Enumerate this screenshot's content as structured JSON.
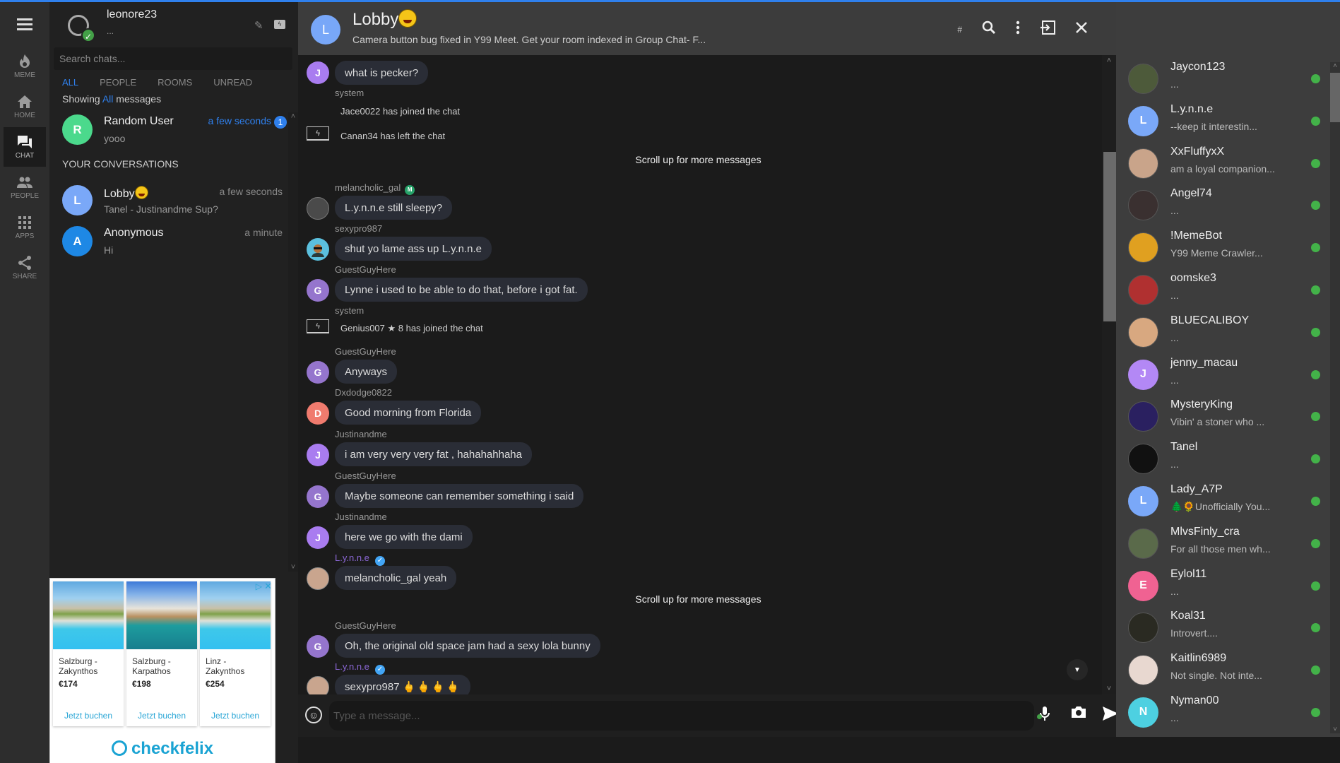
{
  "rail": {
    "items": [
      {
        "label": "MEME",
        "icon": "flame-icon"
      },
      {
        "label": "HOME",
        "icon": "home-icon"
      },
      {
        "label": "CHAT",
        "icon": "chat-icon",
        "active": true
      },
      {
        "label": "PEOPLE",
        "icon": "people-icon"
      },
      {
        "label": "APPS",
        "icon": "apps-grid-icon"
      },
      {
        "label": "SHARE",
        "icon": "share-icon"
      }
    ]
  },
  "profile": {
    "username": "leonore23",
    "status": "..."
  },
  "search": {
    "placeholder": "Search chats..."
  },
  "filters": {
    "tabs": [
      "ALL",
      "PEOPLE",
      "ROOMS",
      "UNREAD"
    ],
    "active": "ALL"
  },
  "showing": {
    "prefix": "Showing",
    "highlight": "All",
    "suffix": "messages"
  },
  "unread_conv": {
    "initial": "R",
    "name": "Random User",
    "preview": "yooo",
    "time": "a few seconds",
    "count": "1",
    "color": "#4bd98c"
  },
  "conversations": {
    "title": "YOUR CONVERSATIONS",
    "items": [
      {
        "initial": "L",
        "name": "Lobby",
        "has_emoji": true,
        "preview": "Tanel - Justinandme Sup?",
        "time": "a few seconds",
        "color": "#7aa8f8"
      },
      {
        "initial": "A",
        "name": "Anonymous",
        "preview": "Hi",
        "time": "a minute",
        "color": "#1e88e5"
      }
    ]
  },
  "ad": {
    "cards": [
      {
        "dest": "Salzburg - Zakynthos",
        "price": "€174",
        "cta": "Jetzt buchen"
      },
      {
        "dest": "Salzburg - Karpathos",
        "price": "€198",
        "cta": "Jetzt buchen"
      },
      {
        "dest": "Linz - Zakynthos",
        "price": "€254",
        "cta": "Jetzt buchen"
      }
    ],
    "brand": "checkfelix"
  },
  "room": {
    "initial": "L",
    "title": "Lobby",
    "description": "Camera button bug fixed in Y99 Meet. Get your room indexed in Group Chat- F...",
    "tools": [
      "hash-icon",
      "search-icon",
      "more-vert-icon",
      "exit-icon",
      "close-icon"
    ]
  },
  "messages": {
    "scroll_more": "Scroll up for more messages",
    "items": [
      {
        "user": "",
        "initial": "J",
        "color": "#a97cf0",
        "text": "what is pecker?"
      },
      {
        "system_label": "system",
        "lines": [
          "Jace0022 has joined the chat",
          "Canan34 has left the chat"
        ]
      },
      {
        "user": "melancholic_gal",
        "badge": "M",
        "avatar": "photo",
        "text": "L.y.n.n.e still sleepy?"
      },
      {
        "user": "sexypro987",
        "avatar": "photo",
        "text": "shut yo lame ass up L.y.n.n.e"
      },
      {
        "user": "GuestGuyHere",
        "initial": "G",
        "color": "#9575cd",
        "text": "Lynne i used to be able to do that, before i got fat."
      },
      {
        "system_label": "system",
        "lines": [
          "Genius007 ★ 8 has joined the chat"
        ]
      },
      {
        "user": "GuestGuyHere",
        "initial": "G",
        "color": "#9575cd",
        "text": "Anyways"
      },
      {
        "user": "Dxdodge0822",
        "initial": "D",
        "color": "#f07b6e",
        "text": "Good morning from Florida"
      },
      {
        "user": "Justinandme",
        "initial": "J",
        "color": "#a97cf0",
        "text": "i am very very very fat , hahahahhaha"
      },
      {
        "user": "GuestGuyHere",
        "initial": "G",
        "color": "#9575cd",
        "text": "Maybe someone can remember something i said"
      },
      {
        "user": "Justinandme",
        "initial": "J",
        "color": "#a97cf0",
        "text": "here we go with the dami"
      },
      {
        "user": "L.y.n.n.e",
        "verified": true,
        "avatar": "photo",
        "text": "melancholic_gal yeah"
      },
      {
        "user": "GuestGuyHere",
        "initial": "G",
        "color": "#9575cd",
        "text": "Oh, the original old space jam had a sexy lola bunny"
      },
      {
        "user": "L.y.n.n.e",
        "verified": true,
        "avatar": "photo",
        "text": "sexypro987",
        "emoji": "🖕🖕🖕🖕"
      }
    ]
  },
  "composer": {
    "placeholder": "Type a message...",
    "value": ""
  },
  "online_users": [
    {
      "name": "Jaycon123",
      "status": "...",
      "avatar": "photo",
      "color": "#4d5a3a"
    },
    {
      "name": "L.y.n.n.e",
      "status": "--keep it interestin...",
      "initial": "L",
      "color": "#7aa8f8"
    },
    {
      "name": "XxFluffyxX",
      "status": "am a loyal companion...",
      "avatar": "photo",
      "color": "#c9a48a"
    },
    {
      "name": "Angel74",
      "status": "...",
      "avatar": "photo",
      "color": "#3a3030"
    },
    {
      "name": "!MemeBot",
      "status": "Y99 Meme Crawler...",
      "avatar": "photo",
      "color": "#e0a020"
    },
    {
      "name": "oomske3",
      "status": "...",
      "avatar": "photo",
      "color": "#b03030"
    },
    {
      "name": "BLUECALIBOY",
      "status": "...",
      "avatar": "photo",
      "color": "#d8a880"
    },
    {
      "name": "jenny_macau",
      "status": "...",
      "initial": "J",
      "color": "#b388f5"
    },
    {
      "name": "MysteryKing",
      "status": "Vibin' a stoner who ...",
      "avatar": "photo",
      "color": "#2a2060"
    },
    {
      "name": "Tanel",
      "status": "...",
      "avatar": "photo",
      "color": "#111111"
    },
    {
      "name": "Lady_A7P",
      "status": "🌲🌻Unofficially You...",
      "initial": "L",
      "color": "#7aa8f8"
    },
    {
      "name": "MlvsFinly_cra",
      "status": "For all those men wh...",
      "avatar": "photo",
      "color": "#5a6a4a"
    },
    {
      "name": "Eylol11",
      "status": "...",
      "initial": "E",
      "color": "#f06292"
    },
    {
      "name": "Koal31",
      "status": "Introvert....",
      "avatar": "photo",
      "color": "#2a2a22"
    },
    {
      "name": "Kaitlin6989",
      "status": "Not single. Not inte...",
      "avatar": "photo",
      "color": "#e8d8d0"
    },
    {
      "name": "Nyman00",
      "status": "...",
      "initial": "N",
      "color": "#4dd0e1"
    }
  ]
}
